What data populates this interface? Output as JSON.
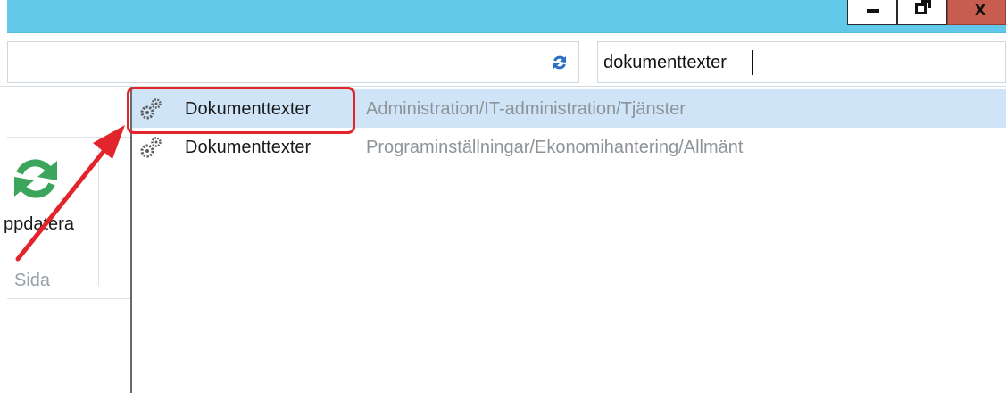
{
  "window": {
    "minimize_icon": "minimize-icon",
    "maximize_icon": "maximize-icon",
    "close_icon": "close-icon",
    "close_glyph": "x",
    "titlebar_color": "#62c8ea"
  },
  "toolbar": {
    "refresh_icon": "refresh-icon",
    "search_value": "dokumenttexter"
  },
  "ribbon": {
    "update_label": "ppdatera",
    "group_label": "Sida",
    "update_icon": "refresh-icon"
  },
  "results": [
    {
      "icon": "gears-icon",
      "name": "Dokumenttexter",
      "path": "Administration/IT-administration/Tjänster",
      "selected": true
    },
    {
      "icon": "gears-icon",
      "name": "Dokumenttexter",
      "path": "Programinställningar/Ekonomihantering/Allmänt",
      "selected": false
    }
  ],
  "annotation": {
    "color": "#e3242b"
  }
}
